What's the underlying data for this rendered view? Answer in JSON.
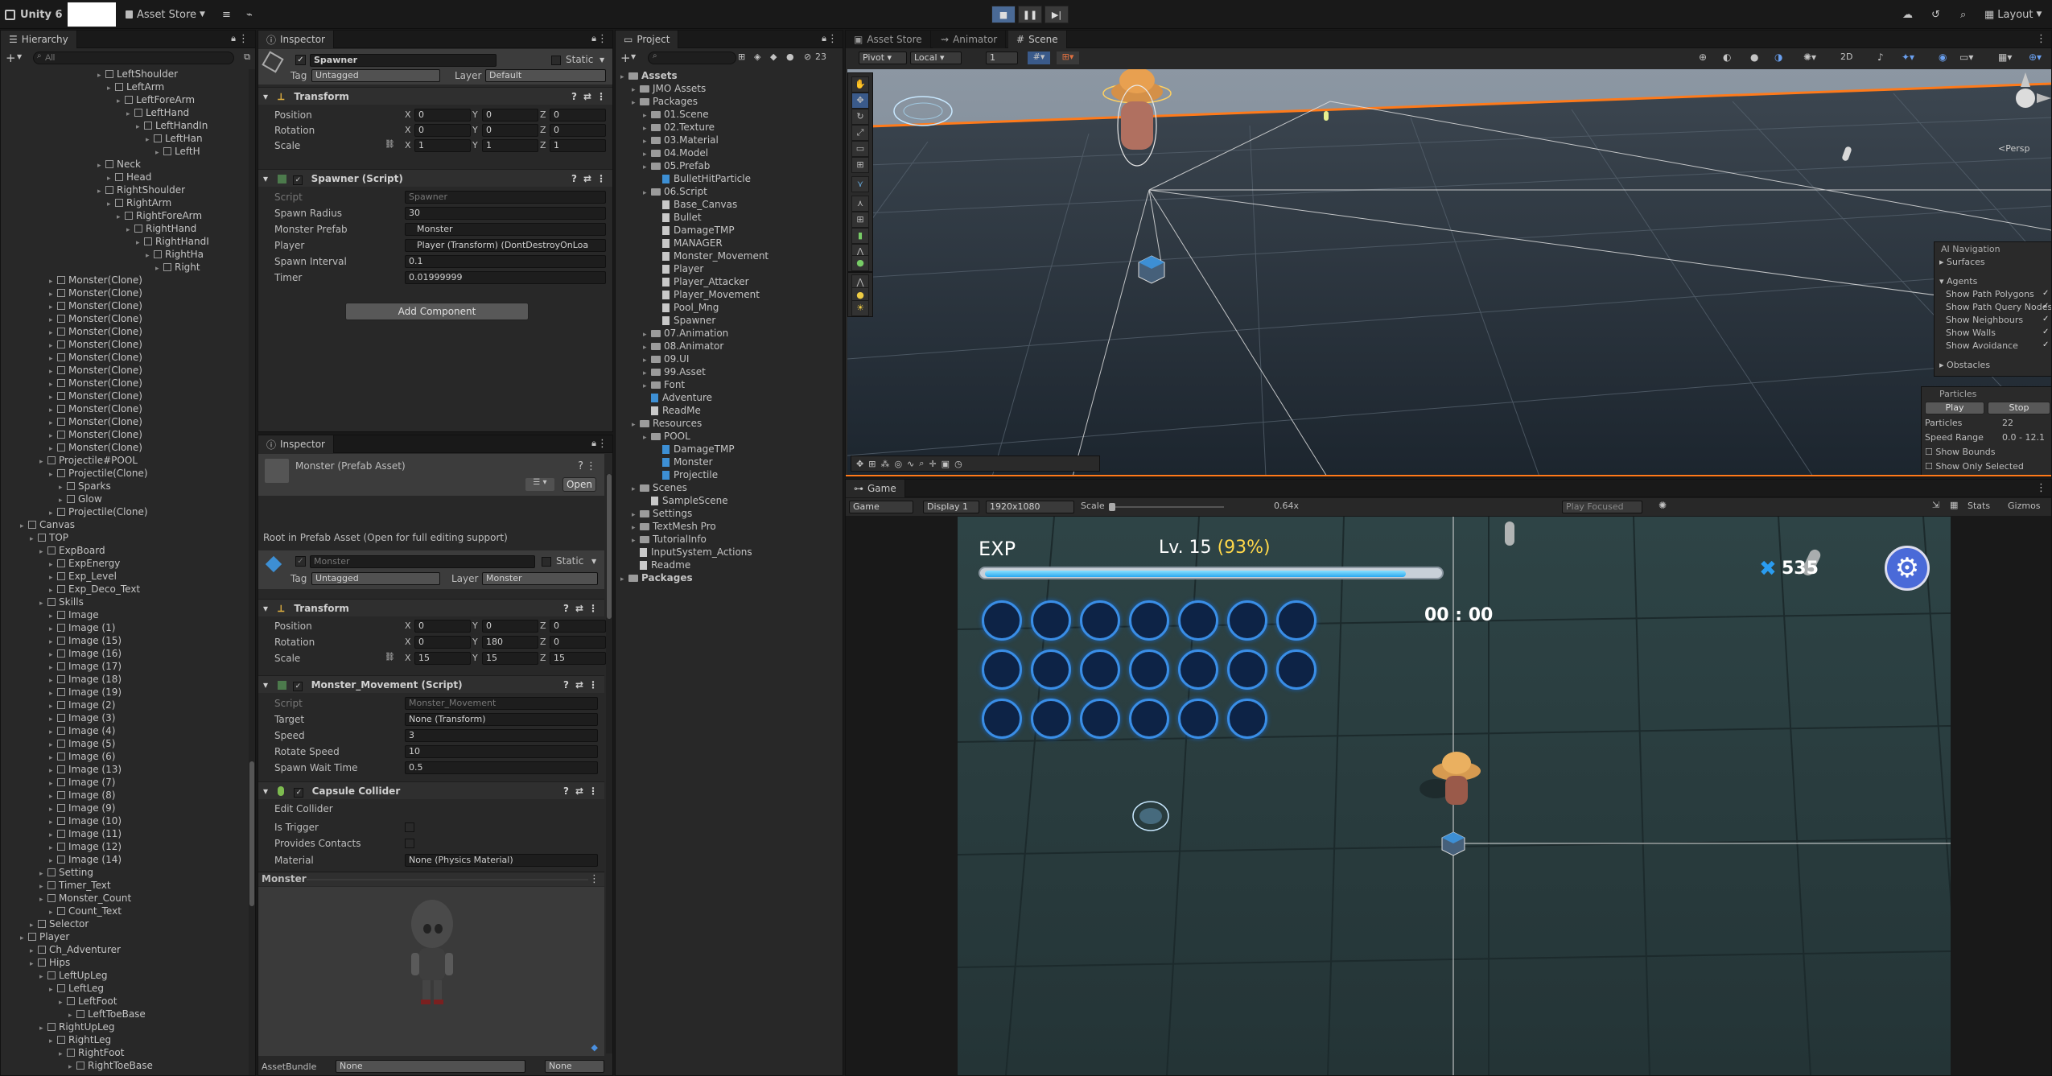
{
  "toolbar": {
    "app_label": "Unity 6",
    "asset_store": "Asset Store",
    "layout": "Layout",
    "play_icon": "play-icon",
    "pause_icon": "pause-icon",
    "step_icon": "step-icon"
  },
  "hierarchy": {
    "tab": "Hierarchy",
    "search_placeholder": "All",
    "items": [
      {
        "label": "LeftShoulder",
        "indent": 10
      },
      {
        "label": "LeftArm",
        "indent": 11
      },
      {
        "label": "LeftForeArm",
        "indent": 12
      },
      {
        "label": "LeftHand",
        "indent": 13
      },
      {
        "label": "LeftHandIn",
        "indent": 14
      },
      {
        "label": "LeftHan",
        "indent": 15
      },
      {
        "label": "LeftH",
        "indent": 16
      },
      {
        "label": "Neck",
        "indent": 10
      },
      {
        "label": "Head",
        "indent": 11
      },
      {
        "label": "RightShoulder",
        "indent": 10
      },
      {
        "label": "RightArm",
        "indent": 11
      },
      {
        "label": "RightForeArm",
        "indent": 12
      },
      {
        "label": "RightHand",
        "indent": 13
      },
      {
        "label": "RightHandI",
        "indent": 14
      },
      {
        "label": "RightHa",
        "indent": 15
      },
      {
        "label": "Right",
        "indent": 16
      },
      {
        "label": "Monster(Clone)",
        "indent": 5
      },
      {
        "label": "Monster(Clone)",
        "indent": 5
      },
      {
        "label": "Monster(Clone)",
        "indent": 5
      },
      {
        "label": "Monster(Clone)",
        "indent": 5
      },
      {
        "label": "Monster(Clone)",
        "indent": 5
      },
      {
        "label": "Monster(Clone)",
        "indent": 5
      },
      {
        "label": "Monster(Clone)",
        "indent": 5
      },
      {
        "label": "Monster(Clone)",
        "indent": 5
      },
      {
        "label": "Monster(Clone)",
        "indent": 5
      },
      {
        "label": "Monster(Clone)",
        "indent": 5
      },
      {
        "label": "Monster(Clone)",
        "indent": 5
      },
      {
        "label": "Monster(Clone)",
        "indent": 5
      },
      {
        "label": "Monster(Clone)",
        "indent": 5
      },
      {
        "label": "Monster(Clone)",
        "indent": 5
      },
      {
        "label": "Projectile#POOL",
        "indent": 4
      },
      {
        "label": "Projectile(Clone)",
        "indent": 5
      },
      {
        "label": "Sparks",
        "indent": 6
      },
      {
        "label": "Glow",
        "indent": 6
      },
      {
        "label": "Projectile(Clone)",
        "indent": 5
      },
      {
        "label": "Canvas",
        "indent": 2
      },
      {
        "label": "TOP",
        "indent": 3
      },
      {
        "label": "ExpBoard",
        "indent": 4
      },
      {
        "label": "ExpEnergy",
        "indent": 5
      },
      {
        "label": "Exp_Level",
        "indent": 5
      },
      {
        "label": "Exp_Deco_Text",
        "indent": 5
      },
      {
        "label": "Skills",
        "indent": 4
      },
      {
        "label": "Image",
        "indent": 5
      },
      {
        "label": "Image (1)",
        "indent": 5
      },
      {
        "label": "Image (15)",
        "indent": 5
      },
      {
        "label": "Image (16)",
        "indent": 5
      },
      {
        "label": "Image (17)",
        "indent": 5
      },
      {
        "label": "Image (18)",
        "indent": 5
      },
      {
        "label": "Image (19)",
        "indent": 5
      },
      {
        "label": "Image (2)",
        "indent": 5
      },
      {
        "label": "Image (3)",
        "indent": 5
      },
      {
        "label": "Image (4)",
        "indent": 5
      },
      {
        "label": "Image (5)",
        "indent": 5
      },
      {
        "label": "Image (6)",
        "indent": 5
      },
      {
        "label": "Image (13)",
        "indent": 5
      },
      {
        "label": "Image (7)",
        "indent": 5
      },
      {
        "label": "Image (8)",
        "indent": 5
      },
      {
        "label": "Image (9)",
        "indent": 5
      },
      {
        "label": "Image (10)",
        "indent": 5
      },
      {
        "label": "Image (11)",
        "indent": 5
      },
      {
        "label": "Image (12)",
        "indent": 5
      },
      {
        "label": "Image (14)",
        "indent": 5
      },
      {
        "label": "Setting",
        "indent": 4
      },
      {
        "label": "Timer_Text",
        "indent": 4
      },
      {
        "label": "Monster_Count",
        "indent": 4
      },
      {
        "label": "Count_Text",
        "indent": 5
      },
      {
        "label": "Selector",
        "indent": 3
      },
      {
        "label": "Player",
        "indent": 2
      },
      {
        "label": "Ch_Adventurer",
        "indent": 3
      },
      {
        "label": "Hips",
        "indent": 3
      },
      {
        "label": "LeftUpLeg",
        "indent": 4
      },
      {
        "label": "LeftLeg",
        "indent": 5
      },
      {
        "label": "LeftFoot",
        "indent": 6
      },
      {
        "label": "LeftToeBase",
        "indent": 7
      },
      {
        "label": "RightUpLeg",
        "indent": 4
      },
      {
        "label": "RightLeg",
        "indent": 5
      },
      {
        "label": "RightFoot",
        "indent": 6
      },
      {
        "label": "RightToeBase",
        "indent": 7
      }
    ]
  },
  "inspector1": {
    "tab": "Inspector",
    "object_name": "Spawner",
    "static_label": "Static",
    "tag_label": "Tag",
    "tag_value": "Untagged",
    "layer_label": "Layer",
    "layer_value": "Default",
    "transform_title": "Transform",
    "position_label": "Position",
    "rotation_label": "Rotation",
    "scale_label": "Scale",
    "position": [
      "0",
      "0",
      "0"
    ],
    "rotation": [
      "0",
      "0",
      "0"
    ],
    "scale": [
      "1",
      "1",
      "1"
    ],
    "script_title": "Spawner (Script)",
    "script_label": "Script",
    "script_value": "Spawner",
    "spawn_radius_label": "Spawn Radius",
    "spawn_radius": "30",
    "monster_prefab_label": "Monster Prefab",
    "monster_prefab": "Monster",
    "player_label": "Player",
    "player_value": "Player (Transform) (DontDestroyOnLoa",
    "spawn_interval_label": "Spawn Interval",
    "spawn_interval": "0.1",
    "timer_label": "Timer",
    "timer_value": "0.01999999",
    "add_component": "Add Component"
  },
  "inspector2": {
    "tab": "Inspector",
    "title": "Monster (Prefab Asset)",
    "open_button": "Open",
    "root_note": "Root in Prefab Asset (Open for full editing support)",
    "object_name": "Monster",
    "static_label": "Static",
    "tag_label": "Tag",
    "tag_value": "Untagged",
    "layer_label": "Layer",
    "layer_value": "Monster",
    "transform_title": "Transform",
    "position_label": "Position",
    "rotation_label": "Rotation",
    "scale_label": "Scale",
    "position": [
      "0",
      "0",
      "0"
    ],
    "rotation": [
      "0",
      "180",
      "0"
    ],
    "scale": [
      "15",
      "15",
      "15"
    ],
    "mm_title": "Monster_Movement (Script)",
    "script_label": "Script",
    "script_value": "Monster_Movement",
    "target_label": "Target",
    "target_value": "None (Transform)",
    "speed_label": "Speed",
    "speed": "3",
    "rotate_speed_label": "Rotate Speed",
    "rotate_speed": "10",
    "spawn_wait_label": "Spawn Wait Time",
    "spawn_wait": "0.5",
    "collider_title": "Capsule Collider",
    "edit_collider": "Edit Collider",
    "is_trigger": "Is Trigger",
    "provides_contacts": "Provides Contacts",
    "material_label": "Material",
    "material_value": "None (Physics Material)",
    "preview_label": "Monster",
    "assetbundle_label": "AssetBundle",
    "assetbundle_value": "None",
    "assetbundle_variant": "None"
  },
  "project": {
    "tab": "Project",
    "count": "23",
    "items": [
      {
        "label": "Assets",
        "indent": 0,
        "kind": "folder",
        "bold": true
      },
      {
        "label": "JMO Assets",
        "indent": 1,
        "kind": "folder"
      },
      {
        "label": "Packages",
        "indent": 1,
        "kind": "folder"
      },
      {
        "label": "01.Scene",
        "indent": 2,
        "kind": "folder"
      },
      {
        "label": "02.Texture",
        "indent": 2,
        "kind": "folder"
      },
      {
        "label": "03.Material",
        "indent": 2,
        "kind": "folder"
      },
      {
        "label": "04.Model",
        "indent": 2,
        "kind": "folder"
      },
      {
        "label": "05.Prefab",
        "indent": 2,
        "kind": "folder"
      },
      {
        "label": "BulletHitParticle",
        "indent": 3,
        "kind": "prefab"
      },
      {
        "label": "06.Script",
        "indent": 2,
        "kind": "folder"
      },
      {
        "label": "Base_Canvas",
        "indent": 3,
        "kind": "file"
      },
      {
        "label": "Bullet",
        "indent": 3,
        "kind": "file"
      },
      {
        "label": "DamageTMP",
        "indent": 3,
        "kind": "file"
      },
      {
        "label": "MANAGER",
        "indent": 3,
        "kind": "file"
      },
      {
        "label": "Monster_Movement",
        "indent": 3,
        "kind": "file"
      },
      {
        "label": "Player",
        "indent": 3,
        "kind": "file"
      },
      {
        "label": "Player_Attacker",
        "indent": 3,
        "kind": "file"
      },
      {
        "label": "Player_Movement",
        "indent": 3,
        "kind": "file"
      },
      {
        "label": "Pool_Mng",
        "indent": 3,
        "kind": "file"
      },
      {
        "label": "Spawner",
        "indent": 3,
        "kind": "file"
      },
      {
        "label": "07.Animation",
        "indent": 2,
        "kind": "folder"
      },
      {
        "label": "08.Animator",
        "indent": 2,
        "kind": "folder"
      },
      {
        "label": "09.UI",
        "indent": 2,
        "kind": "folder"
      },
      {
        "label": "99.Asset",
        "indent": 2,
        "kind": "folder"
      },
      {
        "label": "Font",
        "indent": 2,
        "kind": "folder"
      },
      {
        "label": "Adventure",
        "indent": 2,
        "kind": "prefab"
      },
      {
        "label": "ReadMe",
        "indent": 2,
        "kind": "file"
      },
      {
        "label": "Resources",
        "indent": 1,
        "kind": "folder"
      },
      {
        "label": "POOL",
        "indent": 2,
        "kind": "folder"
      },
      {
        "label": "DamageTMP",
        "indent": 3,
        "kind": "prefab"
      },
      {
        "label": "Monster",
        "indent": 3,
        "kind": "prefab"
      },
      {
        "label": "Projectile",
        "indent": 3,
        "kind": "prefab"
      },
      {
        "label": "Scenes",
        "indent": 1,
        "kind": "folder"
      },
      {
        "label": "SampleScene",
        "indent": 2,
        "kind": "file"
      },
      {
        "label": "Settings",
        "indent": 1,
        "kind": "folder"
      },
      {
        "label": "TextMesh Pro",
        "indent": 1,
        "kind": "folder"
      },
      {
        "label": "TutorialInfo",
        "indent": 1,
        "kind": "folder"
      },
      {
        "label": "InputSystem_Actions",
        "indent": 1,
        "kind": "file"
      },
      {
        "label": "Readme",
        "indent": 1,
        "kind": "file"
      },
      {
        "label": "Packages",
        "indent": 0,
        "kind": "folder",
        "bold": true
      }
    ]
  },
  "scene": {
    "tabs": [
      "Asset Store",
      "Animator",
      "Scene"
    ],
    "pivot": "Pivot",
    "local": "Local",
    "grid_value": "1",
    "persp": "<Persp",
    "ai_nav_title": "AI Navigation",
    "surfaces": "Surfaces",
    "agents": "Agents",
    "nav_options": [
      "Show Path Polygons",
      "Show Path Query Nodes",
      "Show Neighbours",
      "Show Walls",
      "Show Avoidance"
    ],
    "obstacles": "Obstacles",
    "particles_title": "Particles",
    "play_btn": "Play",
    "stop_btn": "Stop",
    "particles_label": "Particles",
    "particles_value": "22",
    "speed_range_label": "Speed Range",
    "speed_range_value": "0.0 - 12.1",
    "show_bounds": "Show Bounds",
    "show_only_selected": "Show Only Selected"
  },
  "game": {
    "tab": "Game",
    "game_label": "Game",
    "display": "Display 1",
    "resolution": "1920x1080",
    "scale_label": "Scale",
    "scale_value": "0.64x",
    "play_focused": "Play Focused",
    "stats": "Stats",
    "gizmos": "Gizmos",
    "exp_label": "EXP",
    "level_text": "Lv. 15",
    "level_pct": "(93%)",
    "exp_fraction": 0.93,
    "timer": "00 : 00",
    "monster_count": "535",
    "skill_rows": [
      7,
      7,
      6
    ]
  }
}
